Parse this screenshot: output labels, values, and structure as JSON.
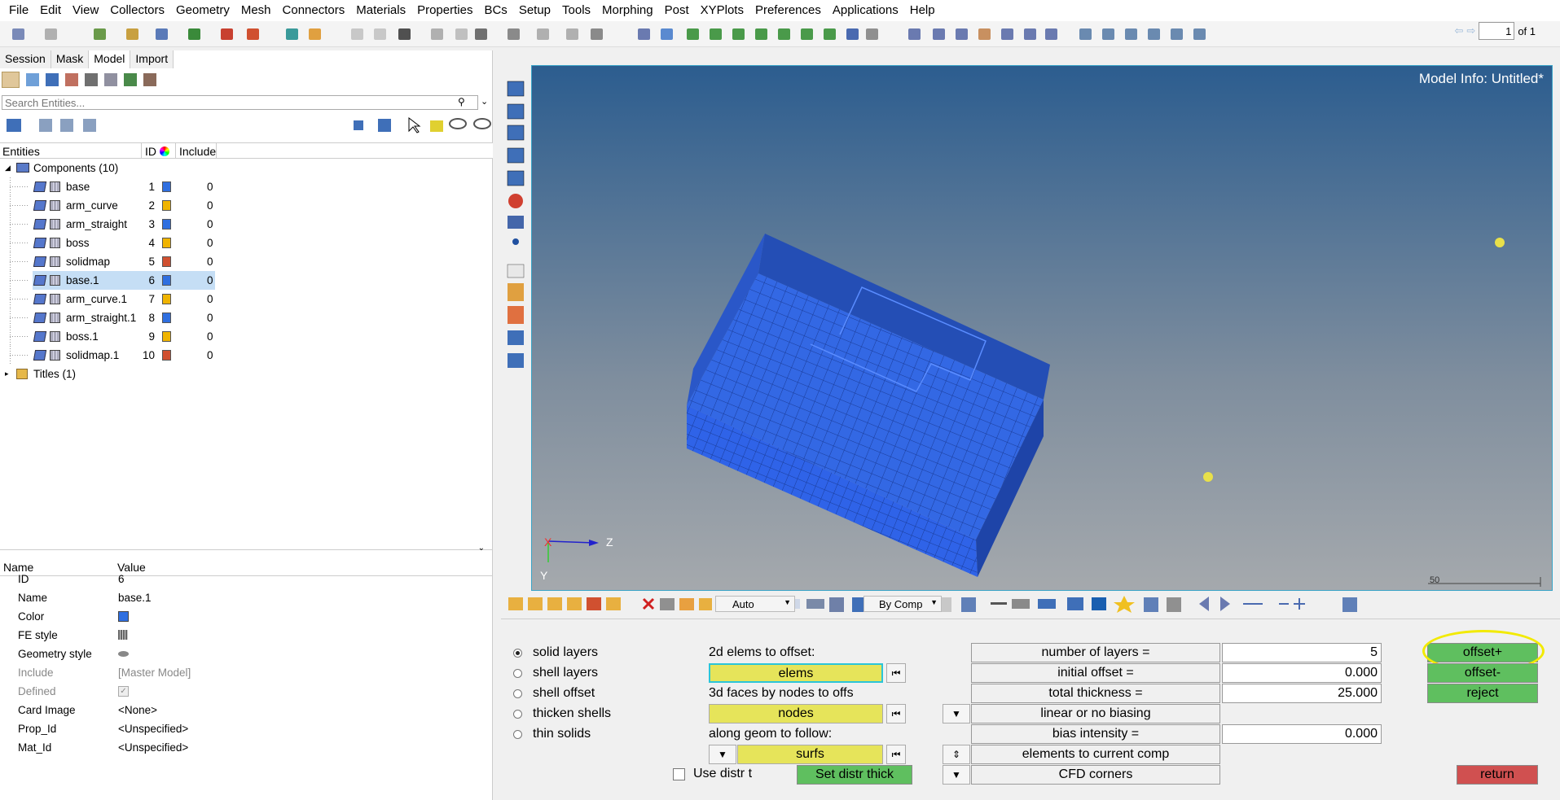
{
  "menu": [
    "File",
    "Edit",
    "View",
    "Collectors",
    "Geometry",
    "Mesh",
    "Connectors",
    "Materials",
    "Properties",
    "BCs",
    "Setup",
    "Tools",
    "Morphing",
    "Post",
    "XYPlots",
    "Preferences",
    "Applications",
    "Help"
  ],
  "pager": {
    "current": "1",
    "of_label": "of 1"
  },
  "browser_tabs": [
    "Session",
    "Mask",
    "Model",
    "Import"
  ],
  "search_placeholder": "Search Entities...",
  "tree_header": {
    "entities": "Entities",
    "id": "ID",
    "include": "Include"
  },
  "tree": {
    "components_label": "Components (10)",
    "titles_label": "Titles (1)",
    "rows": [
      {
        "name": "base",
        "id": "1",
        "include": "0",
        "color": "#2f6fe0"
      },
      {
        "name": "arm_curve",
        "id": "2",
        "include": "0",
        "color": "#f0b400"
      },
      {
        "name": "arm_straight",
        "id": "3",
        "include": "0",
        "color": "#2f6fe0"
      },
      {
        "name": "boss",
        "id": "4",
        "include": "0",
        "color": "#f0b400"
      },
      {
        "name": "solidmap",
        "id": "5",
        "include": "0",
        "color": "#d05030"
      },
      {
        "name": "base.1",
        "id": "6",
        "include": "0",
        "color": "#2f6fe0"
      },
      {
        "name": "arm_curve.1",
        "id": "7",
        "include": "0",
        "color": "#f0b400"
      },
      {
        "name": "arm_straight.1",
        "id": "8",
        "include": "0",
        "color": "#2f6fe0"
      },
      {
        "name": "boss.1",
        "id": "9",
        "include": "0",
        "color": "#f0b400"
      },
      {
        "name": "solidmap.1",
        "id": "10",
        "include": "0",
        "color": "#d05030"
      }
    ]
  },
  "props_header": {
    "name": "Name",
    "value": "Value"
  },
  "props": [
    {
      "name": "ID",
      "value": "6"
    },
    {
      "name": "Name",
      "value": "base.1"
    },
    {
      "name": "Color",
      "value": ""
    },
    {
      "name": "FE style",
      "value": ""
    },
    {
      "name": "Geometry style",
      "value": ""
    },
    {
      "name": "Include",
      "value": "[Master Model]"
    },
    {
      "name": "Defined",
      "value": ""
    },
    {
      "name": "Card Image",
      "value": "<None>"
    },
    {
      "name": "Prop_Id",
      "value": "<Unspecified>"
    },
    {
      "name": "Mat_Id",
      "value": "<Unspecified>"
    }
  ],
  "viewport": {
    "model_info": "Model Info: Untitled*",
    "scale": "50",
    "axis_x": "X",
    "axis_y": "Y",
    "axis_z": "Z"
  },
  "bottom_toolbar": {
    "auto_label": "Auto",
    "bycomp_label": "By Comp"
  },
  "panel": {
    "radios": [
      "solid layers",
      "shell layers",
      "shell offset",
      "thicken shells",
      "thin solids"
    ],
    "selected_radio": 0,
    "label_2d": "2d elems to offset:",
    "elems_btn": "elems",
    "label_3d": "3d faces by nodes to offs",
    "nodes_btn": "nodes",
    "label_geom": "along geom to follow:",
    "surfs_btn": "surfs",
    "use_distr": "Use distr t",
    "set_distr": "Set distr thick",
    "num_layers_label": "number of layers  =",
    "num_layers": "5",
    "init_offset_label": "initial offset    =",
    "init_offset": "0.000",
    "total_thick_label": "total thickness =",
    "total_thick": "25.000",
    "biasing_label": "linear or no biasing",
    "bias_intensity_label": "bias intensity    =",
    "bias_intensity": "0.000",
    "current_comp_label": "elements to current comp",
    "cfd_label": "CFD corners",
    "offset_plus": "offset+",
    "offset_minus": "offset-",
    "reject": "reject",
    "return": "return"
  }
}
